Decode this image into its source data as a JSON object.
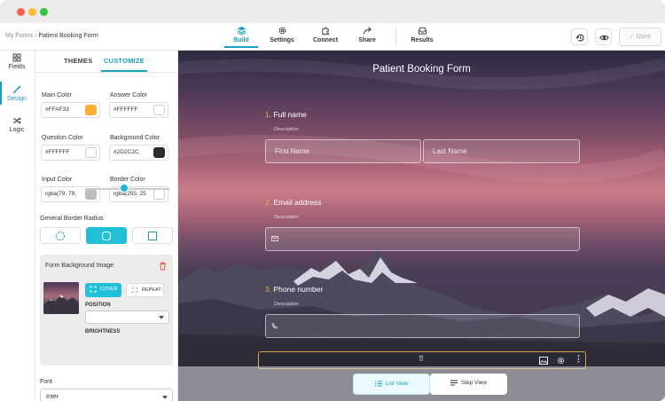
{
  "window": {
    "traffic_lights": [
      "#fe5f57",
      "#febc2e",
      "#28c840"
    ]
  },
  "breadcrumb": {
    "parent": "My Forms",
    "separator": "›",
    "current": "Patient Booking Form"
  },
  "topnav": {
    "items": [
      {
        "label": "Build",
        "icon": "layers-icon",
        "active": true
      },
      {
        "label": "Settings",
        "icon": "gear-icon"
      },
      {
        "label": "Connect",
        "icon": "puzzle-icon"
      },
      {
        "label": "Share",
        "icon": "share-icon"
      },
      {
        "label": "Results",
        "icon": "inbox-icon"
      }
    ],
    "done_label": "Done",
    "done_icon": "check-icon",
    "history_icon": "history-icon",
    "preview_icon": "eye-icon"
  },
  "rail": {
    "items": [
      {
        "label": "Fields",
        "icon": "grid-icon"
      },
      {
        "label": "Design",
        "icon": "brush-icon",
        "active": true
      },
      {
        "label": "Logic",
        "icon": "shuffle-icon"
      }
    ]
  },
  "design_panel": {
    "tabs": [
      "THEMES",
      "CUSTOMIZE"
    ],
    "active_tab": "CUSTOMIZE",
    "colors": {
      "main": {
        "label": "Main Color",
        "value": "#FFAF33",
        "swatch": "#FFAF33"
      },
      "answer": {
        "label": "Answer Color",
        "value": "#FFFFFF",
        "swatch": "#FFFFFF"
      },
      "question": {
        "label": "Question Color",
        "value": "#FFFFFF",
        "swatch": "#FFFFFF"
      },
      "background": {
        "label": "Background Color",
        "value": "#2D2C2C",
        "swatch": "#2D2C2C"
      },
      "input": {
        "label": "Input Color",
        "value": "rgba(79, 79,",
        "swatch": "#BDBDBD"
      },
      "border": {
        "label": "Border Color",
        "value": "rgba(255, 25",
        "swatch": "#FFFFFF"
      }
    },
    "border_radius": {
      "label": "General Border Radius",
      "selected": 1
    },
    "background_image": {
      "label": "Form Background Image",
      "cover_label": "COVER",
      "repeat_label": "REPEAT",
      "position_label": "POSITION",
      "brightness_label": "BRIGHTNESS",
      "brightness_level": 0.5,
      "delete_icon": "trash-icon"
    },
    "font": {
      "label": "Font",
      "value": "Inter"
    }
  },
  "form": {
    "title": "Patient Booking Form",
    "accent": "#F2B134",
    "questions": [
      {
        "number": "1.",
        "label": "Full name",
        "description": "Description",
        "fields": [
          "First Name",
          "Last Name"
        ]
      },
      {
        "number": "2.",
        "label": "Email address",
        "description": "Description",
        "icon": "mail-icon"
      },
      {
        "number": "3.",
        "label": "Phone number",
        "description": "Description",
        "icon": "phone-icon"
      }
    ]
  },
  "view_toggle": {
    "list_label": "List View",
    "step_label": "Step View",
    "active": "list"
  }
}
